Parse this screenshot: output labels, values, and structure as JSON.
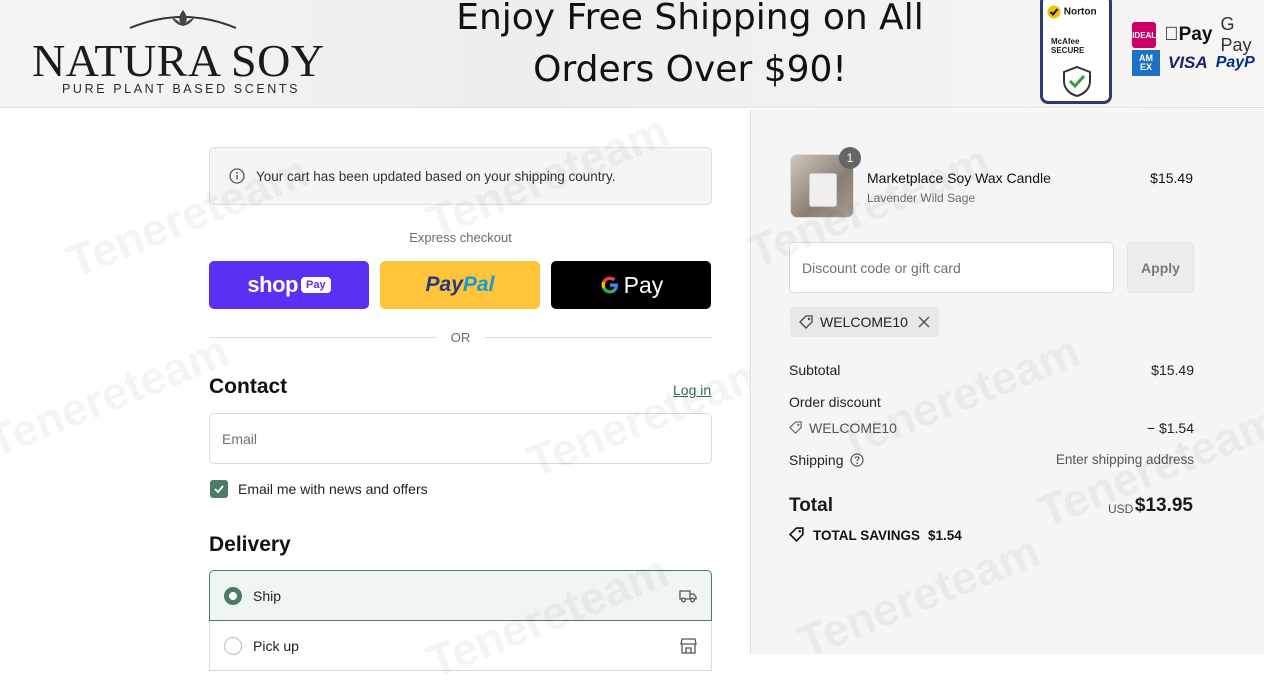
{
  "header": {
    "logo_text": "NATURA SOY",
    "logo_tagline": "PURE PLANT BASED SCENTS",
    "promo_line1": "Enjoy Free Shipping on All",
    "promo_line2": "Orders Over $90!",
    "trust_badges": {
      "norton": "Norton",
      "mcafee": "McAfee SECURE"
    },
    "payment_logos": {
      "ideal": "iDEAL",
      "apple_pay": "Pay",
      "google_pay": "G Pay",
      "amex": "AM EX",
      "visa": "VISA",
      "paypal": "PayP"
    }
  },
  "notice": {
    "text": "Your cart has been updated based on your shipping country."
  },
  "express": {
    "label": "Express checkout",
    "shop_pay": {
      "shop": "shop",
      "pay": "Pay"
    },
    "paypal": {
      "pay": "Pay",
      "pal": "Pal"
    },
    "google_pay": {
      "g": "G",
      "pay": "Pay"
    },
    "or": "OR"
  },
  "contact": {
    "heading": "Contact",
    "login": "Log in",
    "email_placeholder": "Email",
    "marketing_label": "Email me with news and offers",
    "marketing_checked": true
  },
  "delivery": {
    "heading": "Delivery",
    "options": [
      {
        "label": "Ship",
        "selected": true,
        "icon": "truck-icon"
      },
      {
        "label": "Pick up",
        "selected": false,
        "icon": "store-icon"
      }
    ]
  },
  "summary": {
    "item": {
      "quantity": "1",
      "name": "Marketplace Soy Wax Candle",
      "variant": "Lavender Wild Sage",
      "price": "$15.49"
    },
    "discount_placeholder": "Discount code or gift card",
    "apply_label": "Apply",
    "applied_code": "WELCOME10",
    "subtotal_label": "Subtotal",
    "subtotal_value": "$15.49",
    "order_discount_label": "Order discount",
    "discount_code": "WELCOME10",
    "discount_value": "− $1.54",
    "shipping_label": "Shipping",
    "shipping_value": "Enter shipping address",
    "total_label": "Total",
    "currency": "USD",
    "total_value": "$13.95",
    "savings_label": "TOTAL SAVINGS",
    "savings_value": "$1.54"
  },
  "watermark": "Tenereteam",
  "colors": {
    "accent_green": "#4d7c64",
    "shop_pay_purple": "#5a31f4",
    "paypal_yellow": "#ffc439",
    "link_green": "#2f6f50"
  }
}
